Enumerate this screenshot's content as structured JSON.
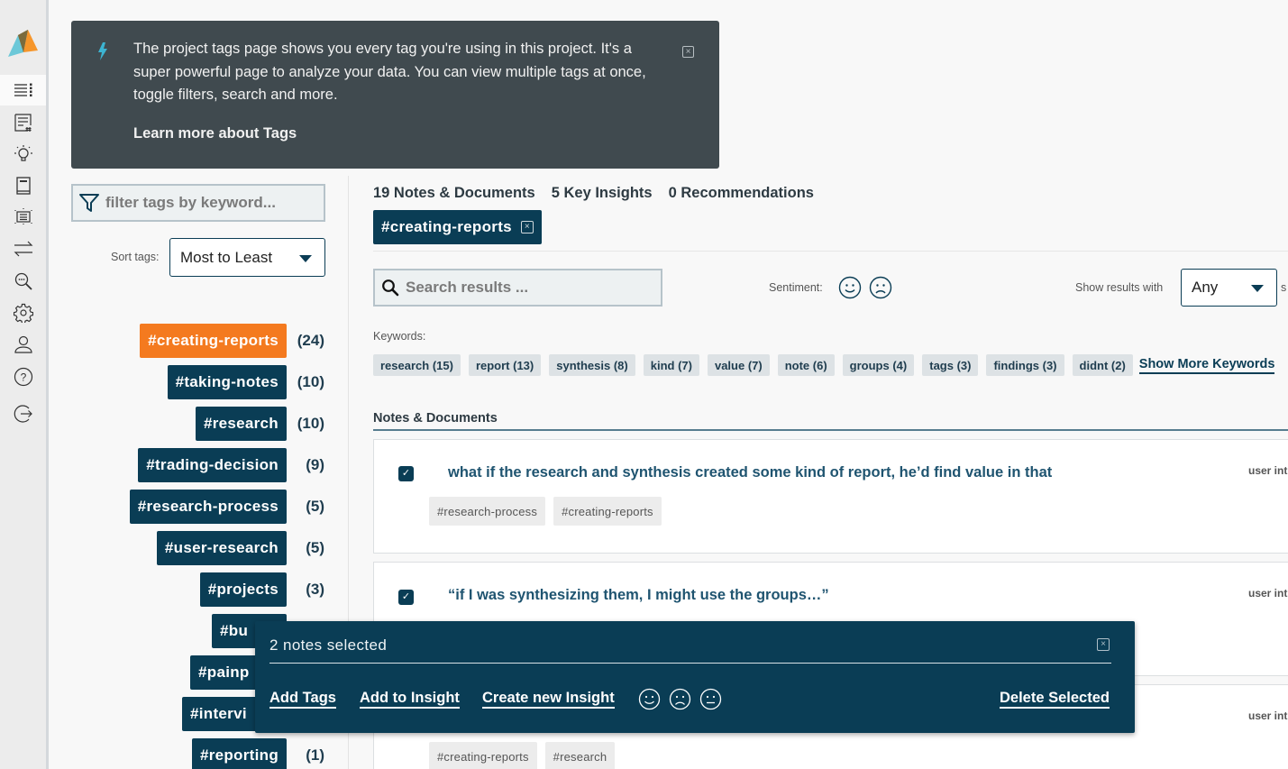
{
  "sidebar": {
    "logo": "app-logo",
    "items": [
      {
        "name": "tags-list",
        "icon": "list-icon",
        "active": true
      },
      {
        "name": "notes",
        "icon": "note-hash-icon"
      },
      {
        "name": "insights",
        "icon": "lightbulb-icon"
      },
      {
        "name": "recommendations",
        "icon": "book-icon"
      },
      {
        "name": "presentation",
        "icon": "presentation-icon"
      },
      {
        "name": "integrations",
        "icon": "arrows-exchange-icon"
      },
      {
        "name": "search",
        "icon": "search-dots-icon"
      },
      {
        "name": "settings",
        "icon": "gear-icon"
      },
      {
        "name": "profile",
        "icon": "user-icon"
      },
      {
        "name": "help",
        "icon": "help-icon"
      },
      {
        "name": "logout",
        "icon": "logout-icon"
      }
    ]
  },
  "banner": {
    "text": "The project tags page shows you every tag you're using in this project. It's a super powerful page to analyze your data. You can view multiple tags at once, toggle filters, search and more.",
    "link": "Learn more about Tags",
    "close": "×"
  },
  "tag_panel": {
    "filter_placeholder": "filter tags by keyword...",
    "sort_label": "Sort tags:",
    "sort_value": "Most to Least",
    "tags": [
      {
        "label": "#creating-reports",
        "count": "(24)",
        "selected": true
      },
      {
        "label": "#taking-notes",
        "count": "(10)"
      },
      {
        "label": "#research",
        "count": "(10)"
      },
      {
        "label": "#trading-decision",
        "count": "(9)"
      },
      {
        "label": "#research-process",
        "count": "(5)"
      },
      {
        "label": "#user-research",
        "count": "(5)"
      },
      {
        "label": "#projects",
        "count": "(3)"
      },
      {
        "label": "#bu",
        "count": ""
      },
      {
        "label": "#painp",
        "count": ""
      },
      {
        "label": "#intervi",
        "count": ""
      },
      {
        "label": "#reporting",
        "count": "(1)"
      }
    ]
  },
  "main": {
    "counts": [
      "19 Notes & Documents",
      "5 Key Insights",
      "0 Recommendations"
    ],
    "active_filter": "#creating-reports",
    "active_filter_close": "×",
    "search_placeholder": "Search results ...",
    "sentiment_label": "Sentiment:",
    "show_results_label": "Show results with",
    "show_results_value": "Any",
    "cut_text": "s",
    "keywords_label": "Keywords:",
    "keywords": [
      "research (15)",
      "report (13)",
      "synthesis (8)",
      "kind (7)",
      "value (7)",
      "note (6)",
      "groups (4)",
      "tags (3)",
      "findings (3)",
      "didnt (2)"
    ],
    "show_more_keywords": "Show More Keywords",
    "section_title": "Notes & Documents",
    "notes": [
      {
        "checked": true,
        "title": "what if the research and synthesis created some kind of report, he’d find value in that",
        "tags": [
          "#research-process",
          "#creating-reports"
        ],
        "source": "user int"
      },
      {
        "checked": true,
        "title": "“if I was synthesizing them, I might use the groups…”",
        "tags": [],
        "source": "user int"
      },
      {
        "checked": false,
        "title": "",
        "tags": [
          "#creating-reports",
          "#research"
        ],
        "source": "user int"
      }
    ]
  },
  "selection_bar": {
    "count_text": "2 notes selected",
    "close": "×",
    "actions": [
      "Add Tags",
      "Add to Insight",
      "Create new Insight"
    ],
    "delete": "Delete Selected"
  },
  "colors": {
    "primary": "#0a3d55",
    "accent": "#f47a1f",
    "banner": "#404a4f"
  }
}
